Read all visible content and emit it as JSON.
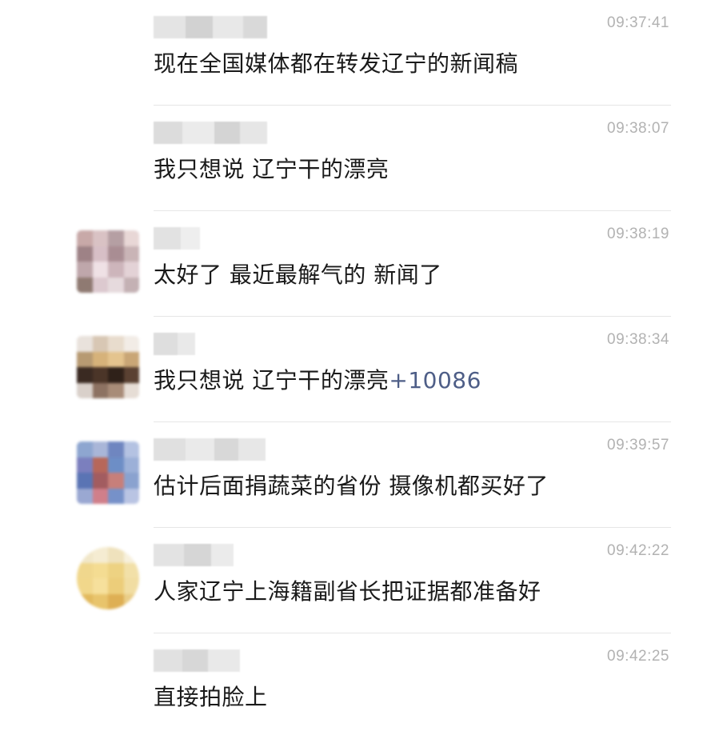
{
  "colors": {
    "background": "#ffffff",
    "text": "#1a1a1a",
    "timestamp": "#b2b2b2",
    "divider": "#e6e6e6",
    "mention": "#4e5e87"
  },
  "comments": [
    {
      "time": "09:37:41",
      "text": "现在全国媒体都在转发辽宁的新闻稿",
      "suffix": ""
    },
    {
      "time": "09:38:07",
      "text": "我只想说 辽宁干的漂亮",
      "suffix": ""
    },
    {
      "time": "09:38:19",
      "text": "太好了  最近最解气的 新闻了",
      "suffix": ""
    },
    {
      "time": "09:38:34",
      "text": "我只想说 辽宁干的漂亮",
      "suffix": "+10086"
    },
    {
      "time": "09:39:57",
      "text": "估计后面捐蔬菜的省份 摄像机都买好了",
      "suffix": ""
    },
    {
      "time": "09:42:22",
      "text": "人家辽宁上海籍副省长把证据都准备好",
      "suffix": ""
    },
    {
      "time": "09:42:25",
      "text": "直接拍脸上",
      "suffix": ""
    }
  ]
}
